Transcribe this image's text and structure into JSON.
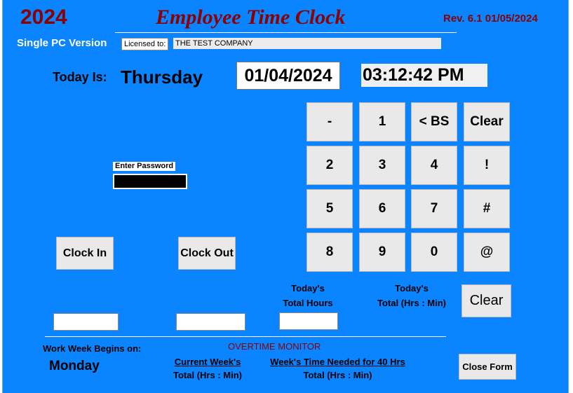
{
  "header": {
    "year": "2024",
    "title": "Employee Time Clock",
    "revision": "Rev. 6.1 01/05/2024",
    "version": "Single PC Version",
    "licensed_label": "Licensed to:",
    "licensed_value": "THE TEST COMPANY"
  },
  "today": {
    "label": "Today Is:",
    "day": "Thursday",
    "date": "01/04/2024",
    "time": "03:12:42 PM"
  },
  "keypad": {
    "keys": [
      "-",
      "1",
      "< BS",
      "Clear",
      "2",
      "3",
      "4",
      "!",
      "5",
      "6",
      "7",
      "#",
      "8",
      "9",
      "0",
      "@"
    ]
  },
  "password": {
    "label": "Enter Password",
    "value": ""
  },
  "buttons": {
    "clock_in": "Clock In",
    "clock_out": "Clock Out",
    "clear": "Clear",
    "close_form": "Close Form"
  },
  "totals": {
    "clock_in_value": "",
    "clock_out_value": "",
    "today_hours_line1": "Today's",
    "today_hours_line2": "Total Hours",
    "today_hours_value": "",
    "today_total_line1": "Today's",
    "today_total_line2": "Total (Hrs : Min)"
  },
  "work_week": {
    "label": "Work Week Begins on:",
    "day": "Monday"
  },
  "overtime": {
    "title": "OVERTIME MONITOR",
    "current_week_line1": "Current Week's",
    "current_week_line2": "Total (Hrs : Min)",
    "needed_line1": "Week's Time Needed for 40 Hrs",
    "needed_line2": "Total (Hrs : Min)"
  },
  "colors": {
    "background": "#0a84ff",
    "title": "#8b0000"
  }
}
